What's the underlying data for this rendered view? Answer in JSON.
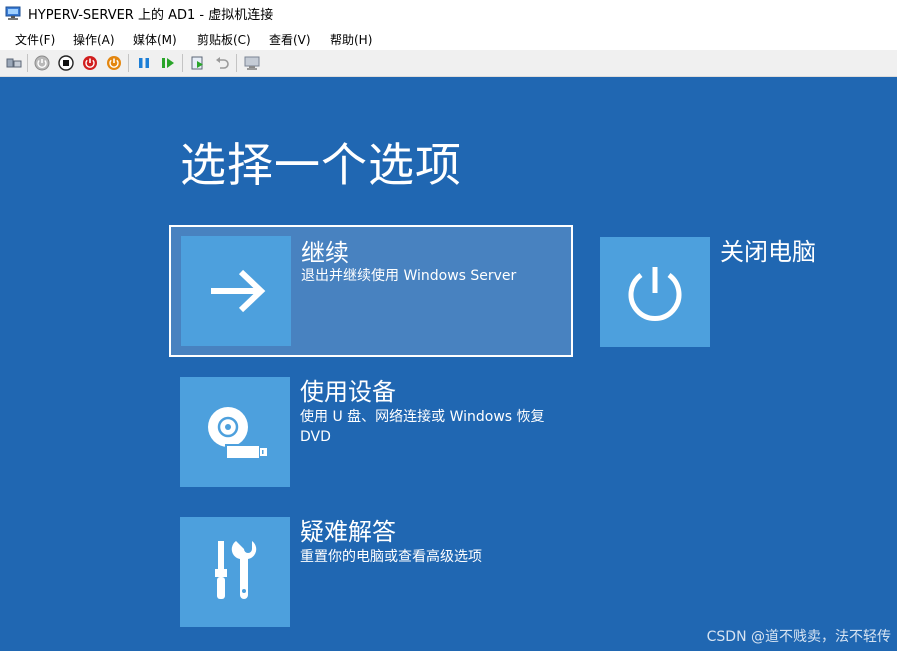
{
  "window": {
    "title": "HYPERV-SERVER 上的 AD1 - 虚拟机连接",
    "icon": "vm-connection-icon"
  },
  "menu": [
    {
      "label": "文件(F)"
    },
    {
      "label": "操作(A)"
    },
    {
      "label": "媒体(M)"
    },
    {
      "label": "剪贴板(C)"
    },
    {
      "label": "查看(V)"
    },
    {
      "label": "帮助(H)"
    }
  ],
  "toolbar": {
    "buttons": [
      {
        "name": "ctrl-alt-del-icon"
      },
      {
        "name": "start-icon"
      },
      {
        "name": "turn-off-icon"
      },
      {
        "name": "shutdown-icon"
      },
      {
        "name": "save-icon"
      },
      {
        "name": "pause-icon"
      },
      {
        "name": "resume-icon"
      },
      {
        "name": "checkpoint-icon"
      },
      {
        "name": "revert-icon"
      },
      {
        "name": "enhanced-session-icon"
      }
    ],
    "colors": {
      "turn_off": "#d11f1f",
      "save": "#e3860f",
      "pause": "#1c7ed6",
      "resume": "#2aa52a"
    }
  },
  "screen": {
    "background": "#2067b2",
    "tile_color": "#4da0dd",
    "heading": "选择一个选项",
    "options": {
      "continue": {
        "title": "继续",
        "desc": "退出并继续使用 Windows Server",
        "icon": "arrow-right-icon"
      },
      "shutdown": {
        "title": "关闭电脑",
        "icon": "power-icon"
      },
      "use_device": {
        "title": "使用设备",
        "desc": "使用 U 盘、网络连接或 Windows 恢复 DVD",
        "icon": "disc-usb-icon"
      },
      "troubleshoot": {
        "title": "疑难解答",
        "desc": "重置你的电脑或查看高级选项",
        "icon": "tools-icon"
      }
    }
  },
  "watermark": "CSDN @道不贱卖，法不轻传"
}
